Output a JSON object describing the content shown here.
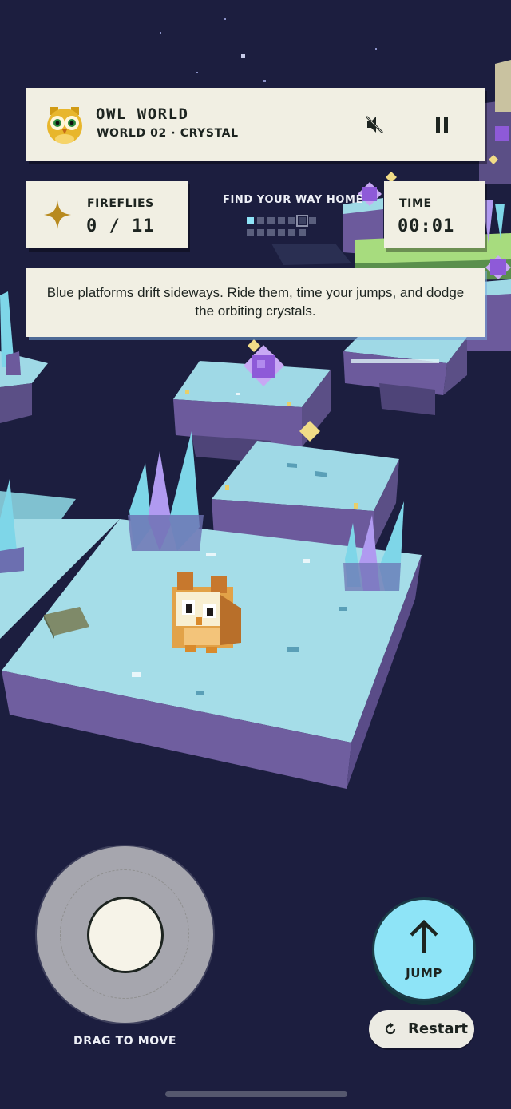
{
  "header": {
    "game_title": "OWL WORLD",
    "world_label": "WORLD 02 · CRYSTAL",
    "mute_icon": "speaker-muted-icon",
    "pause_icon": "pause-icon"
  },
  "fireflies": {
    "label": "FIREFLIES",
    "count": "0 / 11",
    "icon": "sparkle-star-icon",
    "accent": "#b88a1f"
  },
  "objective": {
    "label": "FIND YOUR WAY HOME",
    "progress_total": 13,
    "progress_current": 1
  },
  "timer": {
    "label": "TIME",
    "value": "00:01"
  },
  "hint": {
    "text": "Blue platforms drift sideways. Ride them, time your jumps, and dodge the orbiting crystals."
  },
  "controls": {
    "joystick_label": "DRAG TO MOVE",
    "jump_label": "JUMP",
    "jump_color": "#8ee4f7",
    "restart_label": "Restart"
  },
  "colors": {
    "background": "#1c1e3f",
    "ice_top": "#9fd9e6",
    "ice_side": "#6c5a9c",
    "crystal_cyan": "#7ed6e8",
    "crystal_violet": "#b09af0",
    "orbiting_crystal": "#8e5ad8",
    "panel": "#f1efe3"
  }
}
